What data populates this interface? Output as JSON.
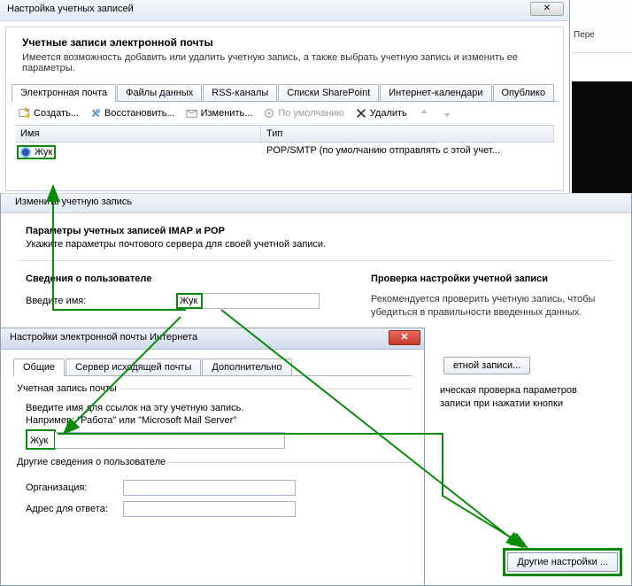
{
  "ribbon": {
    "label": "Пере"
  },
  "win1": {
    "title": "Настройка учетных записей",
    "close_glyph": "✕",
    "intro_title": "Учетные записи электронной почты",
    "intro_text": "Имеется возможность добавить или удалить учетную запись, а также выбрать учетную запись и изменить ее параметры.",
    "tabs": [
      "Электронная почта",
      "Файлы данных",
      "RSS-каналы",
      "Списки SharePoint",
      "Интернет-календари",
      "Опублико"
    ],
    "toolbar": {
      "create": "Создать...",
      "repair": "Восстановить...",
      "edit": "Изменить...",
      "default": "По умолчанию",
      "delete": "Удалить"
    },
    "table": {
      "col_name": "Имя",
      "col_type": "Тип",
      "row_name": "Жук",
      "row_type": "POP/SMTP (по умолчанию отправлять с этой учет..."
    }
  },
  "win2": {
    "title": "Изменить учетную запись",
    "param_title": "Параметры учетных записей IMAP и POP",
    "param_text": "Укажите параметры почтового сервера для своей учетной записи.",
    "user_section": "Сведения о пользователе",
    "name_label": "Введите имя:",
    "name_value": "Жук",
    "check_section": "Проверка настройки учетной записи",
    "check_text": "Рекомендуется проверить учетную запись, чтобы убедиться в правильности введенных данных.",
    "partial_btn": "етной записи...",
    "checkbox_text1": "ическая проверка параметров",
    "checkbox_text2": "записи при нажатии кнопки",
    "other_settings": "Другие настройки ..."
  },
  "win3": {
    "title": "Настройки электронной почты Интернета",
    "close_glyph": "✕",
    "tabs": [
      "Общие",
      "Сервер исходящей почты",
      "Дополнительно"
    ],
    "fieldset1": "Учетная запись почты",
    "desc1": "Введите имя для ссылок на эту учетную запись.",
    "desc2": "Например: \"Работа\" или \"Microsoft Mail Server\"",
    "main_value": "Жук",
    "fieldset2": "Другие сведения о пользователе",
    "org_label": "Организация:",
    "org_value": "",
    "reply_label": "Адрес для ответа:",
    "reply_value": ""
  }
}
